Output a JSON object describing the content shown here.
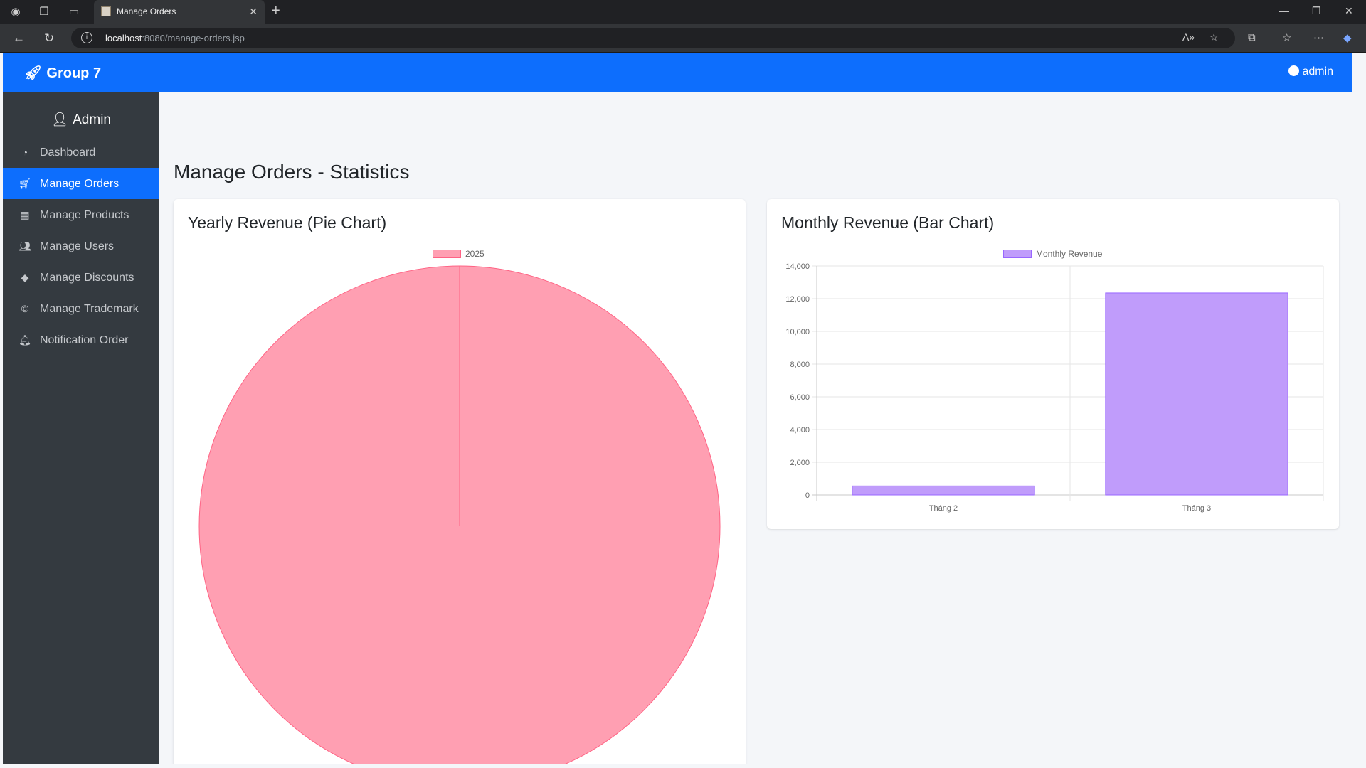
{
  "browser": {
    "tab_title": "Manage Orders",
    "url_host": "localhost",
    "url_rest": ":8080/manage-orders.jsp"
  },
  "navbar": {
    "brand": "Group 7",
    "user": "admin"
  },
  "sidebar": {
    "title": "Admin",
    "items": [
      {
        "label": "Dashboard",
        "icon": "dashboard-icon"
      },
      {
        "label": "Manage Orders",
        "icon": "cart-icon",
        "active": true
      },
      {
        "label": "Manage Products",
        "icon": "boxes-icon"
      },
      {
        "label": "Manage Users",
        "icon": "users-icon"
      },
      {
        "label": "Manage Discounts",
        "icon": "tag-icon"
      },
      {
        "label": "Manage Trademark",
        "icon": "copyright-icon"
      },
      {
        "label": "Notification Order",
        "icon": "bell-icon"
      }
    ]
  },
  "main": {
    "heading": "Manage Orders - Statistics",
    "pie_card_title": "Yearly Revenue (Pie Chart)",
    "bar_card_title": "Monthly Revenue (Bar Chart)"
  },
  "colors": {
    "primary": "#0d6efd",
    "sidebar": "#343a40",
    "pie_fill": "#ff9fb2",
    "pie_border": "#ff6384",
    "bar_fill": "#c09cfb",
    "bar_border": "#9966ff"
  },
  "chart_data": [
    {
      "type": "pie",
      "title": "",
      "labels": [
        "2025"
      ],
      "values": [
        12900
      ],
      "legend": "top"
    },
    {
      "type": "bar",
      "title": "",
      "categories": [
        "Tháng 2",
        "Tháng 3"
      ],
      "series": [
        {
          "name": "Monthly Revenue",
          "values": [
            550,
            12350
          ]
        }
      ],
      "ylim": [
        0,
        14000
      ],
      "yticks": [
        "0",
        "2,000",
        "4,000",
        "6,000",
        "8,000",
        "10,000",
        "12,000",
        "14,000"
      ],
      "grid": true,
      "legend": "top"
    }
  ]
}
